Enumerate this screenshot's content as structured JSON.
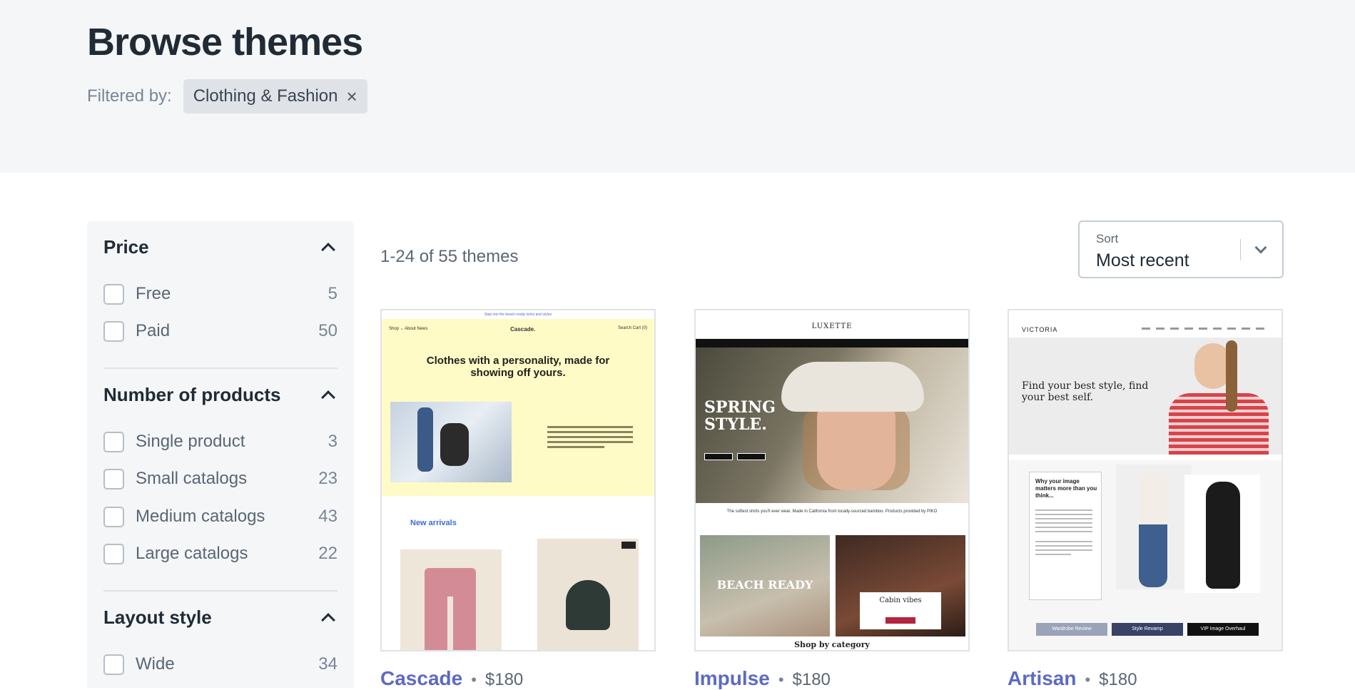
{
  "page": {
    "title": "Browse themes",
    "filtered_by_label": "Filtered by:",
    "active_filter": "Clothing & Fashion",
    "remove_filter_glyph": "×"
  },
  "filters": {
    "price": {
      "title": "Price",
      "options": [
        {
          "label": "Free",
          "count": "5"
        },
        {
          "label": "Paid",
          "count": "50"
        }
      ]
    },
    "products": {
      "title": "Number of products",
      "options": [
        {
          "label": "Single product",
          "count": "3"
        },
        {
          "label": "Small catalogs",
          "count": "23"
        },
        {
          "label": "Medium catalogs",
          "count": "43"
        },
        {
          "label": "Large catalogs",
          "count": "22"
        }
      ]
    },
    "layout": {
      "title": "Layout style",
      "options": [
        {
          "label": "Wide",
          "count": "34"
        }
      ]
    }
  },
  "results": {
    "count_text": "1-24 of 55 themes"
  },
  "sort": {
    "label": "Sort",
    "value": "Most recent"
  },
  "themes": [
    {
      "name": "Cascade",
      "price": "$180",
      "preview": {
        "announcement": "Step into the beach-ready looks and styles",
        "logo": "Cascade.",
        "nav_left": "Shop ⌄   About   News",
        "nav_right": "Search   Cart (0)",
        "headline": "Clothes with a personality, made for showing off yours.",
        "section": "New arrivals"
      }
    },
    {
      "name": "Impulse",
      "price": "$180",
      "preview": {
        "logo": "LUXETTE",
        "hero_title": "SPRING STYLE.",
        "caption": "The softest shirts you'll ever wear. Made in California from locally-sourced bamboo. Products provided by PIKO",
        "tile_left": "BEACH READY",
        "tile_right": "Cabin vibes",
        "section": "Shop by category"
      }
    },
    {
      "name": "Artisan",
      "price": "$180",
      "preview": {
        "logo": "VICTORIA",
        "hero_text": "Find your best style, find your best self.",
        "box_title": "Why your image matters more than you think...",
        "buttons": [
          "Wardrobe Review",
          "Style Revamp",
          "VIP Image Overhaul"
        ]
      }
    }
  ],
  "colors": {
    "accent": "#5c6ac4",
    "hero_bg": "#f4f6f8",
    "chip_bg": "#dfe3e8",
    "text_dark": "#212b36"
  },
  "icons": {
    "chevron_up": "chevron-up-icon",
    "chevron_down": "chevron-down-icon",
    "close": "close-icon"
  }
}
